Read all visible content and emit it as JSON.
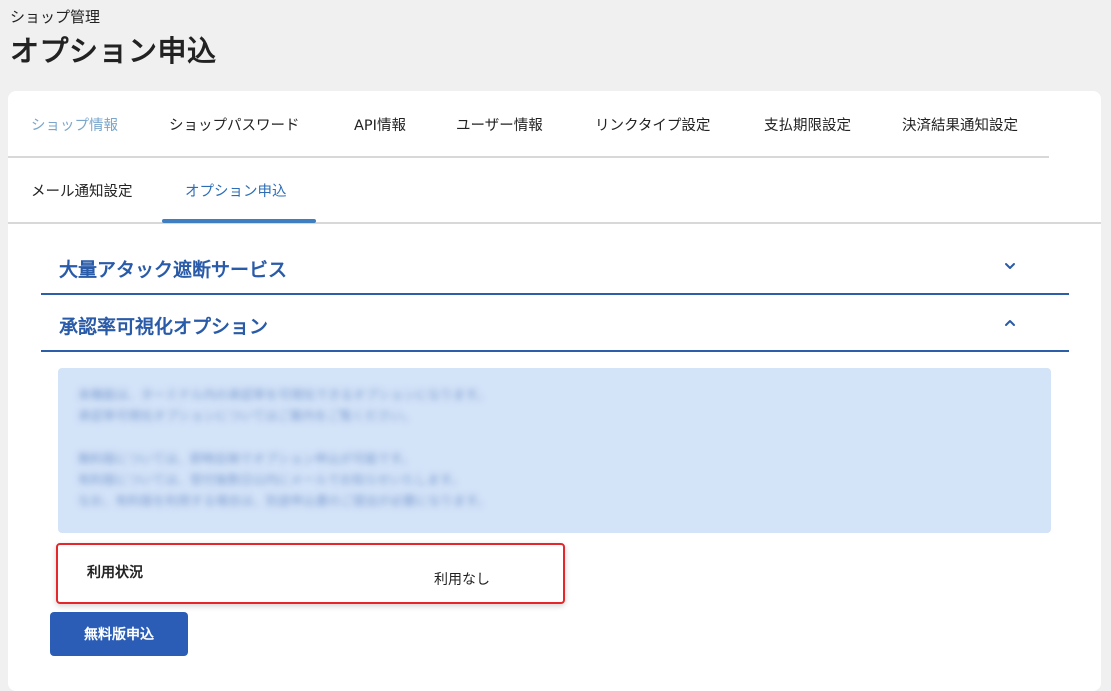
{
  "header": {
    "breadcrumb": "ショップ管理",
    "title": "オプション申込"
  },
  "tabs": {
    "row1": [
      {
        "label": "ショップ情報",
        "state": "muted"
      },
      {
        "label": "ショップパスワード",
        "state": "normal"
      },
      {
        "label": "API情報",
        "state": "normal"
      },
      {
        "label": "ユーザー情報",
        "state": "normal"
      },
      {
        "label": "リンクタイプ設定",
        "state": "normal"
      },
      {
        "label": "支払期限設定",
        "state": "normal"
      },
      {
        "label": "決済結果通知設定",
        "state": "normal"
      }
    ],
    "row2": [
      {
        "label": "メール通知設定",
        "state": "normal"
      },
      {
        "label": "オプション申込",
        "state": "active"
      }
    ]
  },
  "sections": [
    {
      "title": "大量アタック遮断サービス",
      "expanded": false,
      "icon": "chevron-down-icon"
    },
    {
      "title": "承認率可視化オプション",
      "expanded": true,
      "icon": "chevron-up-icon"
    }
  ],
  "info_box": {
    "blurred": true,
    "lines": [
      "本機能は、ターミナル内の承認率を可視化できるオプションになります。",
      "承認率可視化オプションについてはご案内をご覧ください。",
      "無料版については、即時反映でオプション申込が可能です。",
      "有料版については、受付後数日以内にメールでお知らせいたします。",
      "なお、有料版を利用する場合は、別途申込書のご提出が必要になります。"
    ]
  },
  "status": {
    "label": "利用状況",
    "value": "利用なし"
  },
  "apply_button": {
    "label": "無料版申込"
  },
  "colors": {
    "accent": "#2b5db6",
    "section_title": "#2a5ba8",
    "info_bg": "#d3e3f8",
    "highlight_border": "#e5262b"
  }
}
